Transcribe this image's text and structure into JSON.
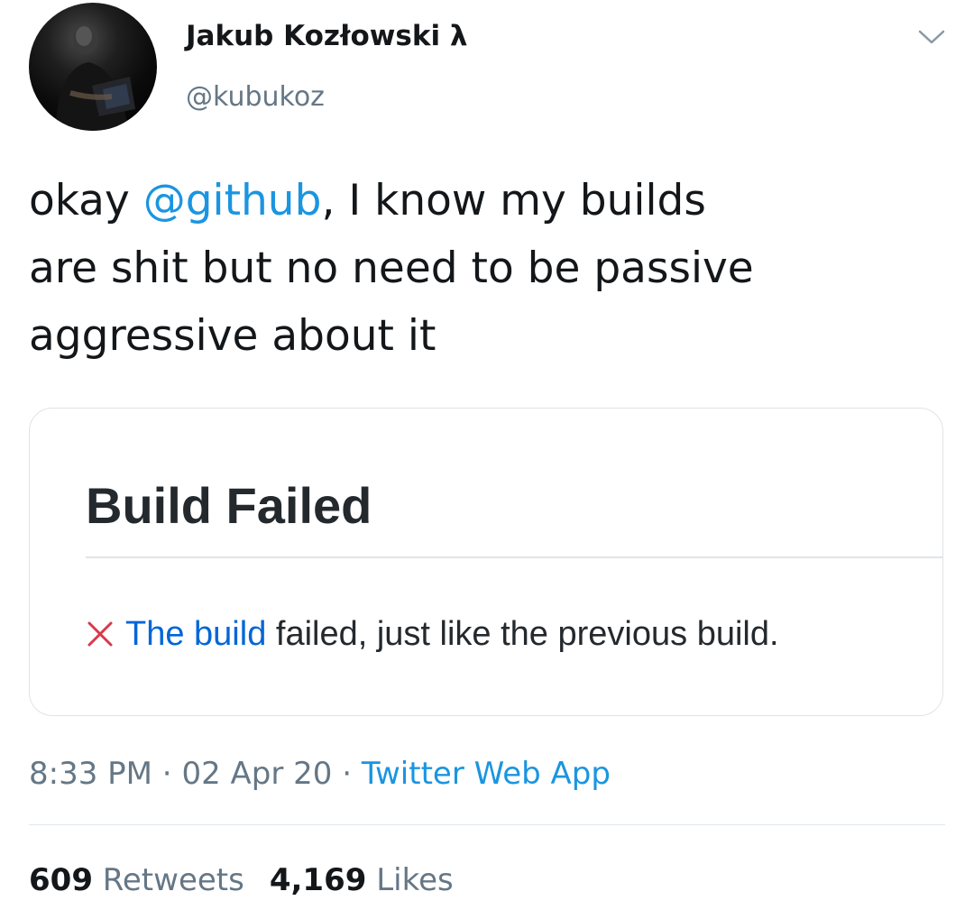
{
  "user": {
    "name": "Jakub Kozłowski λ",
    "handle": "@kubukoz"
  },
  "tweet": {
    "text_before": "okay ",
    "mention": "@github",
    "text_line1_after": ", I know my builds",
    "text_line2": "are shit but no need to be passive",
    "text_line3": "aggressive about it"
  },
  "card": {
    "title": "Build Failed",
    "icon": "x-icon",
    "link_text": "The build",
    "emphasis": "failed",
    "rest": ", just like the previous build."
  },
  "meta": {
    "time": "8:33 PM",
    "sep1": " · ",
    "date": "02 Apr 20",
    "sep2": " · ",
    "source": "Twitter Web App"
  },
  "stats": {
    "retweets_count": "609",
    "retweets_label": "Retweets",
    "likes_count": "4,169",
    "likes_label": "Likes"
  },
  "colors": {
    "link": "#1b95e0",
    "github_link": "#0366d6",
    "secondary": "#657786",
    "fail_red": "#d73a49"
  }
}
